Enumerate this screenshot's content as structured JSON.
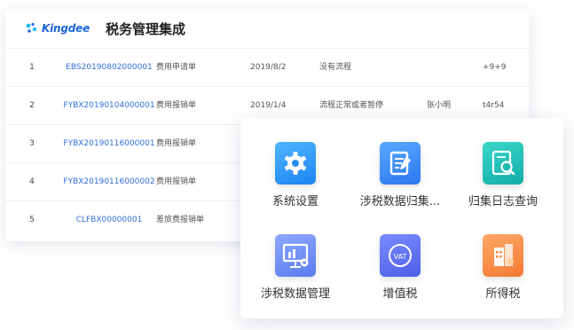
{
  "header": {
    "logo_text": "Kingdee",
    "title": "税务管理集成"
  },
  "rows": [
    {
      "no": "1",
      "code": "EBS20190802000001",
      "type": "费用申请单",
      "date": "2019/8/2",
      "status": "没有流程",
      "user": "",
      "extra": "+9+9"
    },
    {
      "no": "2",
      "code": "FYBX20190104000001",
      "type": "费用报销单",
      "date": "2019/1/4",
      "status": "流程正常或者暂停",
      "user": "张小明",
      "extra": "t4r54"
    },
    {
      "no": "3",
      "code": "FYBX20190116000001",
      "type": "费用报销单",
      "date": "",
      "status": "",
      "user": "",
      "extra": ""
    },
    {
      "no": "4",
      "code": "FYBX20190116000002",
      "type": "费用报销单",
      "date": "",
      "status": "",
      "user": "",
      "extra": ""
    },
    {
      "no": "5",
      "code": "CLFBX00000001",
      "type": "差旅费报销单",
      "date": "",
      "status": "",
      "user": "",
      "extra": ""
    }
  ],
  "apps": [
    {
      "label": "系统设置",
      "icon": "gear-icon",
      "color": "#2b8ef5"
    },
    {
      "label": "涉税数据归集...",
      "icon": "edit-document-icon",
      "color": "#2b83f3"
    },
    {
      "label": "归集日志查询",
      "icon": "search-document-icon",
      "color": "#1fb8b0"
    },
    {
      "label": "涉税数据管理",
      "icon": "presentation-settings-icon",
      "color": "#6f8cf5"
    },
    {
      "label": "增值税",
      "icon": "vat-icon",
      "color": "#5a6ff0"
    },
    {
      "label": "所得税",
      "icon": "buildings-icon",
      "color": "#f5873e"
    }
  ]
}
